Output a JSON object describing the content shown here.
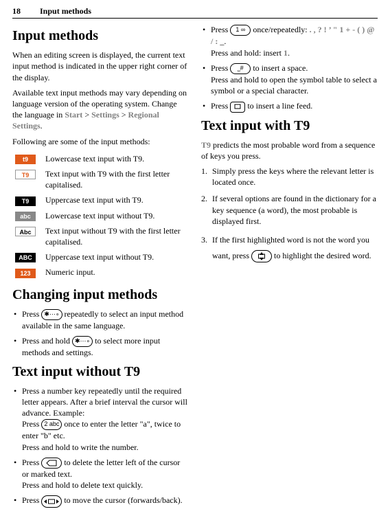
{
  "page": {
    "number": "18",
    "header": "Input methods"
  },
  "sec1": {
    "h": "Input methods",
    "p1": "When an editing screen is displayed, the current text input method is indicated in the upper right corner of the display.",
    "p2a": "Available text input methods may vary depending on language version of the operating system. Change the language in ",
    "p2_path1": "Start",
    "p2_gt1": " > ",
    "p2_path2": "Settings",
    "p2_gt2": " > ",
    "p2_path3": "Regional Settings",
    "p2_dot": ".",
    "p3": "Following are some of the input methods:"
  },
  "icons": [
    {
      "cls": "ic-orange",
      "lbl": "t9",
      "desc": "Lowercase text input with T9."
    },
    {
      "cls": "ic-whiteT9",
      "lbl": "T9",
      "desc": "Text input with T9 with the first letter capitalised."
    },
    {
      "cls": "ic-black",
      "lbl": "T9",
      "desc": "Uppercase text input with T9."
    },
    {
      "cls": "ic-greyabc",
      "lbl": "abc",
      "desc": "Lowercase text input without T9."
    },
    {
      "cls": "ic-whiteabc",
      "lbl": "Abc",
      "desc": "Text input without T9 with the first letter capitalised."
    },
    {
      "cls": "ic-blackabc",
      "lbl": "ABC",
      "desc": "Uppercase text input without T9."
    },
    {
      "cls": "ic-num",
      "lbl": "123",
      "desc": "Numeric input."
    }
  ],
  "sec2": {
    "h": "Changing input methods",
    "b1a": "Press ",
    "b1b": " repeatedly to select an input method available in the same language.",
    "b2a": "Press and hold ",
    "b2b": " to select more input methods and settings."
  },
  "sec3": {
    "h": "Text input without T9",
    "b1l1": "Press a number key repeatedly until the required letter appears. After a brief interval the cursor will advance. Example:",
    "b1l2a": "Press ",
    "b1l2b": " once to enter the letter \"a\", twice to enter \"b\" etc.",
    "b1l3": "Press and hold to write the number.",
    "b2a": "Press ",
    "b2b": " to delete the letter left of the cursor or marked text.",
    "b2c": "Press and hold to delete text quickly.",
    "b3a": "Press ",
    "b3b": " to move the cursor (forwards/back).",
    "b4a": "Press ",
    "b4b": " once/repeatedly: ",
    "b4sym": ". , ? ! ’ \" 1 + - ( ) @ / :",
    "b4u": " _.",
    "b4c_a": "Press and hold: insert ",
    "b4c_sym": "1",
    "b4c_b": ".",
    "b5a": "Press ",
    "b5b": " to insert a space.",
    "b5c": "Press and hold to open the symbol table to select a symbol or a special character.",
    "b6a": "Press ",
    "b6b": " to insert a line feed."
  },
  "sec4": {
    "h": "Text input with T9",
    "p1a": "T9",
    "p1b": " predicts the most probable word from a sequence of keys you press.",
    "o1": "Simply press the keys where the relevant letter is located once.",
    "o2": "If several options are found in the dictionary for a key sequence (a word), the most probable is displayed first.",
    "o3a": "If the first highlighted word is not the word you want, press ",
    "o3b": " to highlight the desired word."
  },
  "keys": {
    "star": "✱⋯∘",
    "two": "2 abc",
    "one": "1 ∞",
    "hash": "⎵#"
  }
}
